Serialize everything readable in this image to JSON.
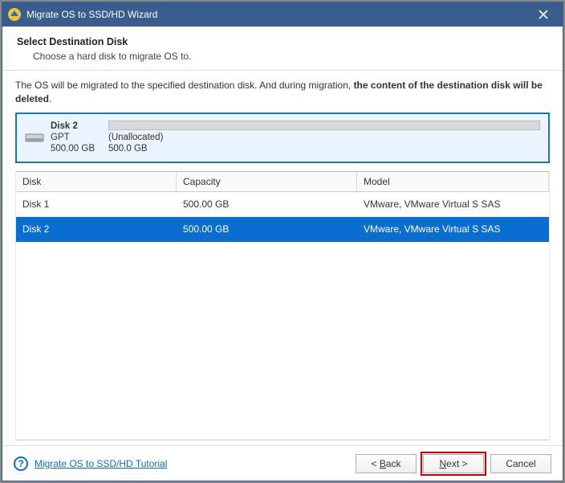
{
  "window": {
    "title": "Migrate OS to SSD/HD Wizard"
  },
  "header": {
    "title": "Select Destination Disk",
    "subtitle": "Choose a hard disk to migrate OS to."
  },
  "warning": {
    "pre": "The OS will be migrated to the specified destination disk. And during migration, ",
    "bold": "the content of the destination disk will be deleted",
    "post": "."
  },
  "preview": {
    "disk_name": "Disk 2",
    "scheme": "GPT",
    "size": "500.00 GB",
    "alloc_label": "(Unallocated)",
    "alloc_size": "500.0 GB"
  },
  "table": {
    "columns": {
      "disk": "Disk",
      "capacity": "Capacity",
      "model": "Model"
    },
    "rows": [
      {
        "disk": "Disk 1",
        "capacity": "500.00 GB",
        "model": "VMware, VMware Virtual S SAS",
        "selected": false
      },
      {
        "disk": "Disk 2",
        "capacity": "500.00 GB",
        "model": "VMware, VMware Virtual S SAS",
        "selected": true
      }
    ]
  },
  "footer": {
    "help_link": "Migrate OS to SSD/HD Tutorial",
    "back_prefix": "< ",
    "back_u": "B",
    "back_rest": "ack",
    "next_u": "N",
    "next_rest": "ext >",
    "cancel": "Cancel"
  }
}
